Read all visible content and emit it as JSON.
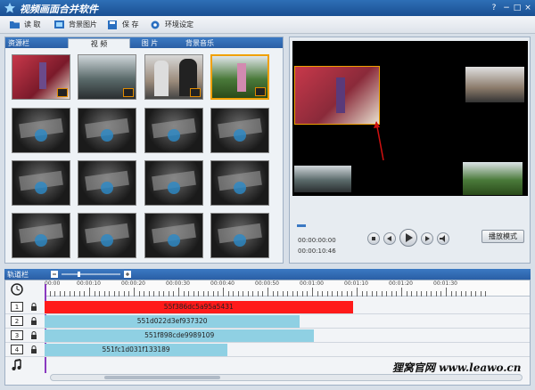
{
  "window": {
    "title": "视频画面合并软件",
    "help": "?",
    "minimize": "−",
    "maximize": "□",
    "close": "×"
  },
  "toolbar": {
    "open_label": "读 取",
    "bgimage_label": "背景图片",
    "save_label": "保 存",
    "settings_label": "环境设定"
  },
  "resource": {
    "label": "资源栏",
    "tabs": [
      "视 频",
      "图 片",
      "背景音乐"
    ],
    "active_tab": 0
  },
  "preview": {
    "time_current": "00:00:00:00",
    "time_total": "00:00:10:46",
    "mode_label": "播放模式"
  },
  "tracks": {
    "label": "轨道栏",
    "ruler": [
      "00:00",
      "00:00:10",
      "00:00:20",
      "00:00:30",
      "00:00:40",
      "00:00:50",
      "00:01:00",
      "00:01:10",
      "00:01:20",
      "00:01:30"
    ],
    "rows": [
      {
        "num": "1",
        "clip": "55f386dc5a95a5431",
        "color": "#ff1a1a",
        "width_fraction": 0.64
      },
      {
        "num": "2",
        "clip": "551d022d3ef937320",
        "color": "#8fd0e3",
        "width_fraction": 0.53
      },
      {
        "num": "3",
        "clip": "551f898cde9989109",
        "color": "#8fd0e3",
        "width_fraction": 0.56
      },
      {
        "num": "4",
        "clip": "551fc1d031f133189",
        "color": "#8fd0e3",
        "width_fraction": 0.38
      }
    ]
  },
  "watermark": "狸窝官网 www.leawo.cn",
  "icons": [
    "app-star-icon",
    "open-folder-icon",
    "image-icon",
    "save-disk-icon",
    "gear-icon",
    "clock-icon",
    "lock-icon",
    "music-note-icon",
    "camera-icon",
    "stop-icon",
    "prev-icon",
    "play-icon",
    "next-icon",
    "volume-icon"
  ]
}
